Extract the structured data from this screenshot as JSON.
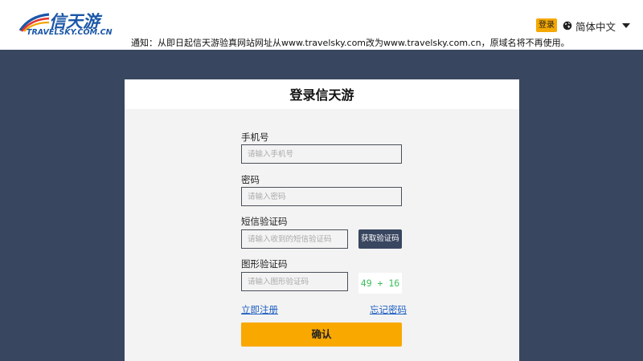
{
  "header": {
    "logo_cn": "信天游",
    "logo_en": "TRAVELSKY.COM.CN",
    "notice": "通知：从即日起信天游验真网站网址从www.travelsky.com改为www.travelsky.com.cn，原域名将不再使用。",
    "login_label": "登录",
    "language_label": "简体中文",
    "icons": {
      "language": "globe-icon",
      "dropdown": "chevron-down-icon"
    }
  },
  "login": {
    "title": "登录信天游",
    "phone": {
      "label": "手机号",
      "placeholder": "请输入手机号"
    },
    "password": {
      "label": "密码",
      "placeholder": "请输入密码"
    },
    "sms": {
      "label": "短信验证码",
      "placeholder": "请输入收到的短信验证码",
      "button": "获取验证码"
    },
    "captcha": {
      "label": "图形验证码",
      "placeholder": "请输入图形验证码",
      "image_text": "49 + 16"
    },
    "register_link": "立即注册",
    "forgot_link": "忘记密码",
    "confirm_label": "确认"
  },
  "colors": {
    "background": "#394660",
    "accent": "#f9a800",
    "link": "#1d5fc2",
    "captcha_text": "#3bbf58"
  }
}
